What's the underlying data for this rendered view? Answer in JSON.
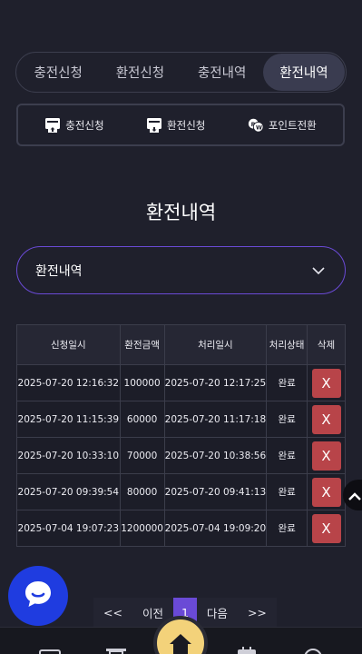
{
  "tabs": [
    {
      "label": "충전신청",
      "active": false
    },
    {
      "label": "환전신청",
      "active": false
    },
    {
      "label": "충전내역",
      "active": false
    },
    {
      "label": "환전내역",
      "active": true
    }
  ],
  "quick_links": [
    {
      "label": "충전신청",
      "icon": "deposit-icon"
    },
    {
      "label": "환전신청",
      "icon": "withdraw-icon"
    },
    {
      "label": "포인트전환",
      "icon": "point-convert-icon"
    }
  ],
  "page_title": "환전내역",
  "select": {
    "value": "환전내역"
  },
  "table": {
    "headers": [
      "신청일시",
      "환전금액",
      "처리일시",
      "처리상태",
      "삭제"
    ],
    "rows": [
      {
        "requested": "2025-07-20 12:16:32",
        "amount": "100000",
        "processed": "2025-07-20 12:17:25",
        "status": "완료",
        "delete": "X"
      },
      {
        "requested": "2025-07-20 11:15:39",
        "amount": "60000",
        "processed": "2025-07-20 11:17:18",
        "status": "완료",
        "delete": "X"
      },
      {
        "requested": "2025-07-20 10:33:10",
        "amount": "70000",
        "processed": "2025-07-20 10:38:56",
        "status": "완료",
        "delete": "X"
      },
      {
        "requested": "2025-07-20 09:39:54",
        "amount": "80000",
        "processed": "2025-07-20 09:41:13",
        "status": "완료",
        "delete": "X"
      },
      {
        "requested": "2025-07-04 19:07:23",
        "amount": "1200000",
        "processed": "2025-07-04 19:09:20",
        "status": "완료",
        "delete": "X"
      }
    ]
  },
  "pager": {
    "first": "<<",
    "prev": "이전",
    "current": "1",
    "next": "다음",
    "last": ">>"
  },
  "colors": {
    "accent": "#6a4ad6",
    "danger": "#b84449",
    "chat": "#1f3ce0",
    "home": "#f3d27a",
    "background": "#1f202c"
  }
}
